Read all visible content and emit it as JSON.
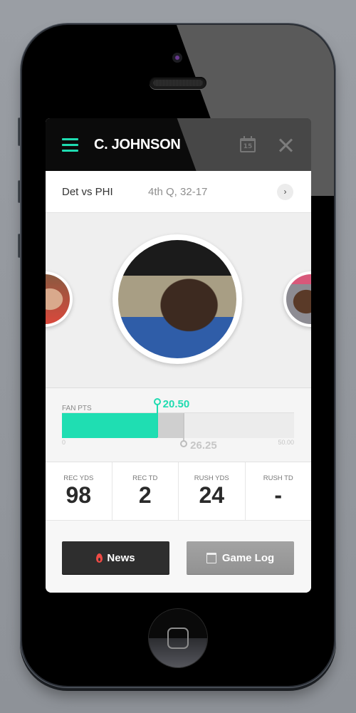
{
  "header": {
    "title": "C. JOHNSON",
    "menu_icon": "hamburger-menu-icon",
    "calendar_icon": "calendar-icon",
    "calendar_day": "15",
    "close_icon": "close-icon"
  },
  "game": {
    "teams": "Det vs PHI",
    "status": "4th Q, 32-17",
    "arrow": "›"
  },
  "players": [
    {
      "position": "previous",
      "description": "player photo"
    },
    {
      "position": "current",
      "description": "C. Johnson photo"
    },
    {
      "position": "next",
      "description": "player photo"
    }
  ],
  "fantasy": {
    "label": "FAN PTS",
    "current": 20.5,
    "current_label": "20.50",
    "projected": 26.25,
    "projected_label": "26.25",
    "min": 0,
    "max": 50,
    "min_label": "0",
    "max_label": "50.00",
    "accent_color": "#1fdeb2"
  },
  "stats": [
    {
      "label": "REC YDS",
      "value": "98"
    },
    {
      "label": "REC TD",
      "value": "2"
    },
    {
      "label": "RUSH YDS",
      "value": "24"
    },
    {
      "label": "RUSH TD",
      "value": "-"
    }
  ],
  "actions": {
    "news_label": "News",
    "news_icon": "flame-icon",
    "gamelog_label": "Game Log",
    "gamelog_icon": "calendar-icon"
  }
}
